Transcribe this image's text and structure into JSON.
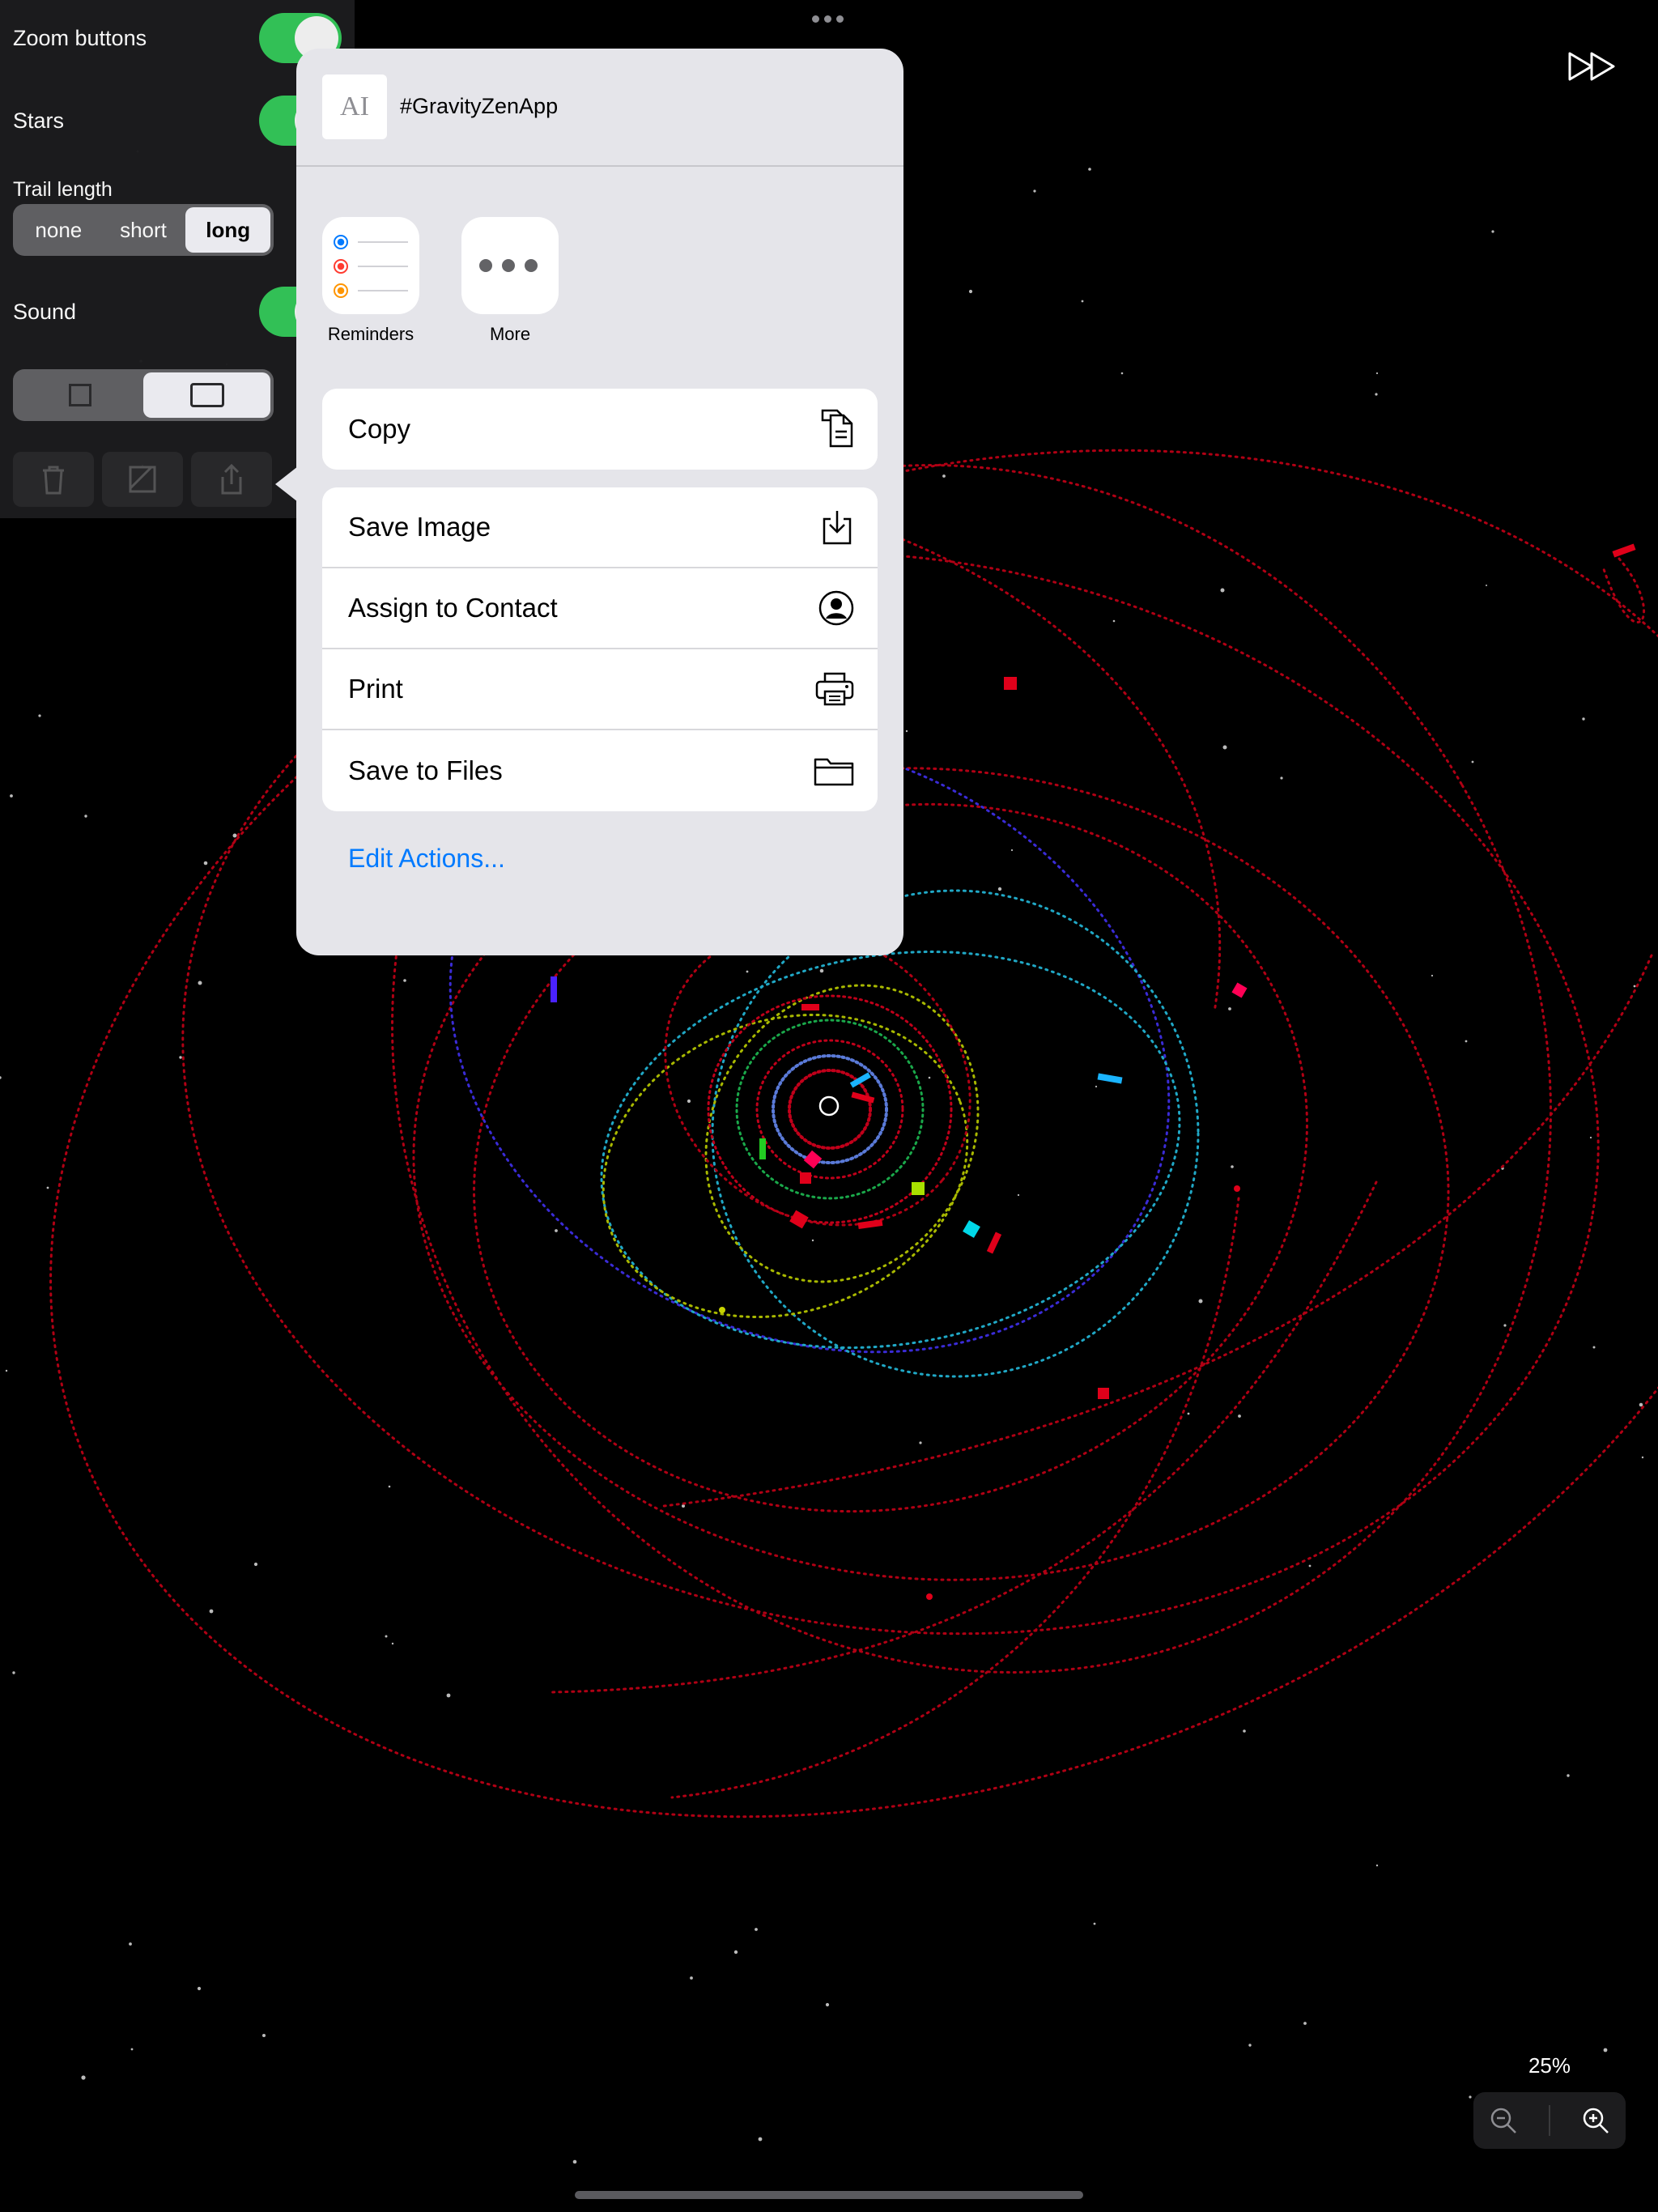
{
  "settings": {
    "zoom_buttons_label": "Zoom buttons",
    "stars_label": "Stars",
    "trail_length_label": "Trail length",
    "trail_options": [
      "none",
      "short",
      "long"
    ],
    "trail_selected": "long",
    "sound_label": "Sound",
    "zoom_buttons_on": true,
    "stars_on": true,
    "sound_on": true
  },
  "share_sheet": {
    "title": "#GravityZenApp",
    "thumb_glyph": "AI",
    "apps": [
      {
        "name": "Reminders",
        "icon": "reminders-icon"
      },
      {
        "name": "More",
        "icon": "more-icon"
      }
    ],
    "copy_label": "Copy",
    "actions": [
      {
        "label": "Save Image",
        "icon": "save-image-icon"
      },
      {
        "label": "Assign to Contact",
        "icon": "contact-icon"
      },
      {
        "label": "Print",
        "icon": "printer-icon"
      },
      {
        "label": "Save to Files",
        "icon": "folder-icon"
      }
    ],
    "edit_actions_label": "Edit Actions..."
  },
  "zoom": {
    "level": "25%"
  },
  "colors": {
    "toggle_on": "#34c759",
    "link": "#007aff",
    "trail_red": "#d0021b",
    "trail_cyan": "#20b8d6",
    "trail_blue": "#3a3aff",
    "trail_yellow": "#c8d400",
    "trail_green": "#22cc22"
  }
}
